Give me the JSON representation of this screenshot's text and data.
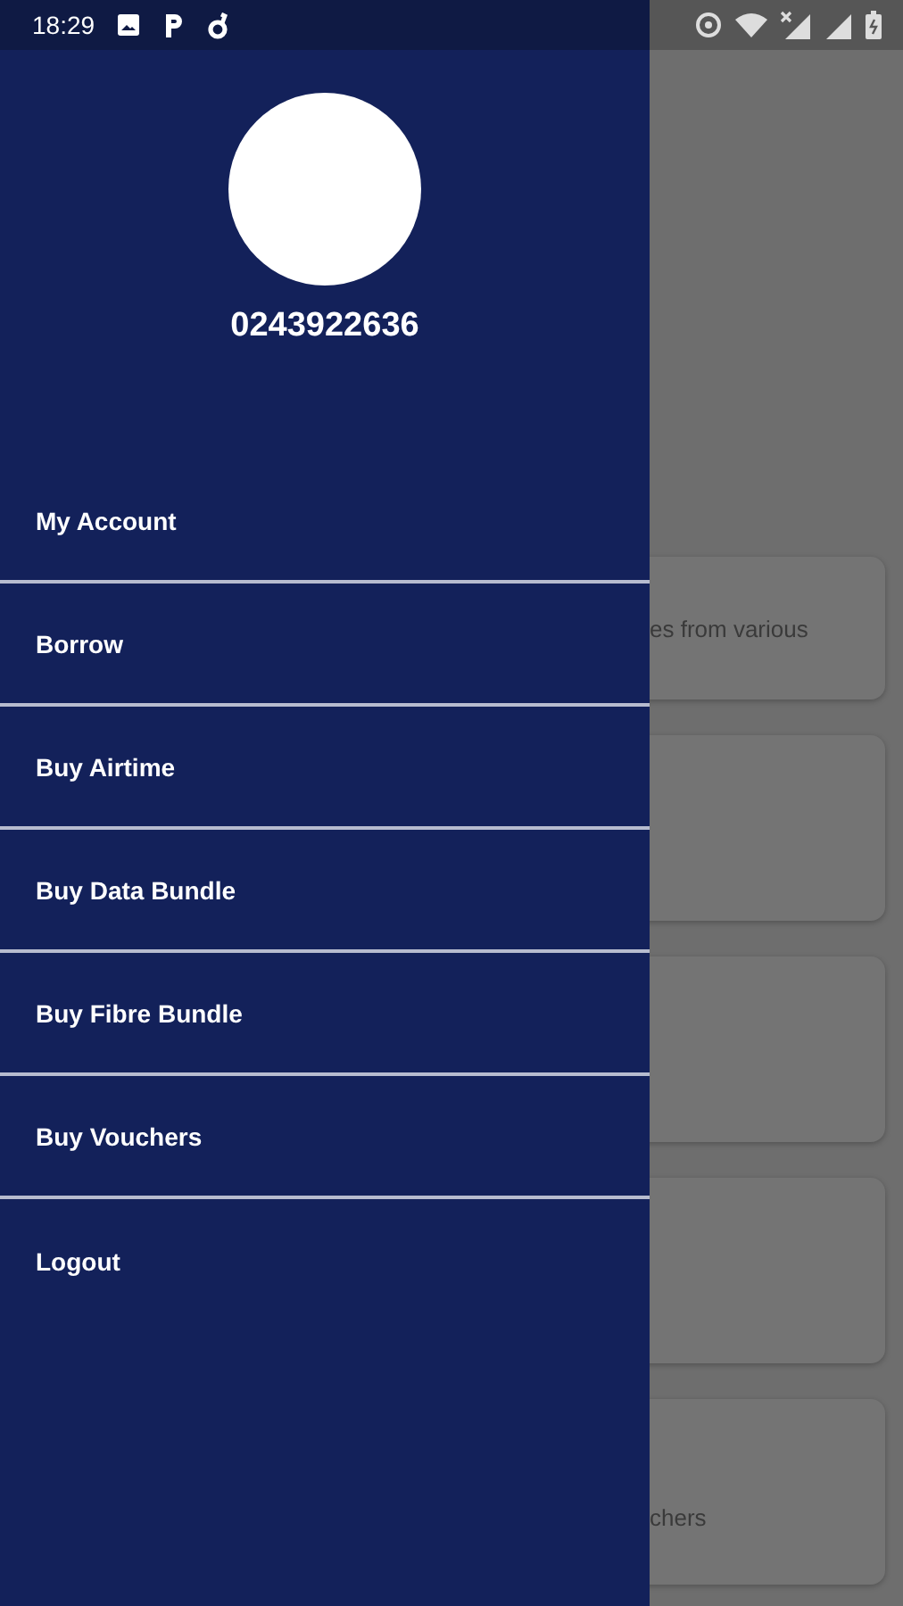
{
  "status_bar": {
    "time": "18:29"
  },
  "drawer": {
    "phone": "0243922636",
    "items": [
      {
        "label": "My Account"
      },
      {
        "label": "Borrow"
      },
      {
        "label": "Buy Airtime"
      },
      {
        "label": "Buy Data Bundle"
      },
      {
        "label": "Buy Fibre Bundle"
      },
      {
        "label": "Buy Vouchers"
      },
      {
        "label": "Logout"
      }
    ]
  },
  "background_cards": [
    {
      "text": "es from various"
    },
    {
      "kind": "blank"
    },
    {
      "kind": "blank"
    },
    {
      "kind": "blank"
    },
    {
      "text": "chers"
    }
  ]
}
